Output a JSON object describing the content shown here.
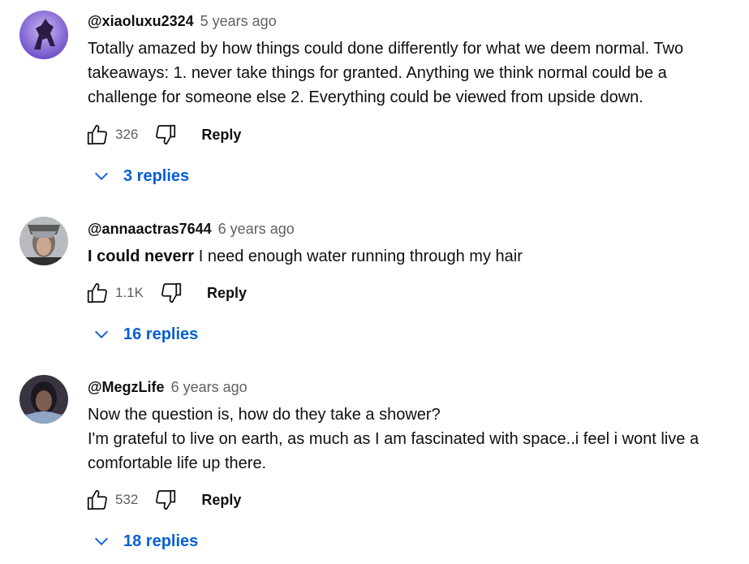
{
  "comments": [
    {
      "author": "@xiaoluxu2324",
      "time": "5 years ago",
      "body_bold": "",
      "lines": [
        "Totally amazed by how things could done differently for what we deem normal. Two",
        "takeaways: 1. never take things for granted. Anything we think normal could be a",
        "challenge for someone else 2. Everything could be viewed from upside down."
      ],
      "likes": "326",
      "reply_label": "Reply",
      "replies_label": "3 replies"
    },
    {
      "author": "@annaactras7644",
      "time": "6 years ago",
      "body_bold": "I could neverr",
      "lines": [
        "I need enough water running through my hair"
      ],
      "likes": "1.1K",
      "reply_label": "Reply",
      "replies_label": "16 replies"
    },
    {
      "author": "@MegzLife",
      "time": "6 years ago",
      "body_bold": "",
      "lines": [
        "Now the question is, how do they take a shower?",
        "I'm grateful to live on earth, as much as I am fascinated with space..i feel i wont live a",
        "comfortable life up there."
      ],
      "likes": "532",
      "reply_label": "Reply",
      "replies_label": "18 replies"
    }
  ],
  "icons": {
    "like": "thumbs-up-icon",
    "dislike": "thumbs-down-icon",
    "expand": "chevron-down-icon"
  },
  "colors": {
    "link": "#065fd4",
    "meta": "#606060",
    "text": "#0f0f0f"
  }
}
